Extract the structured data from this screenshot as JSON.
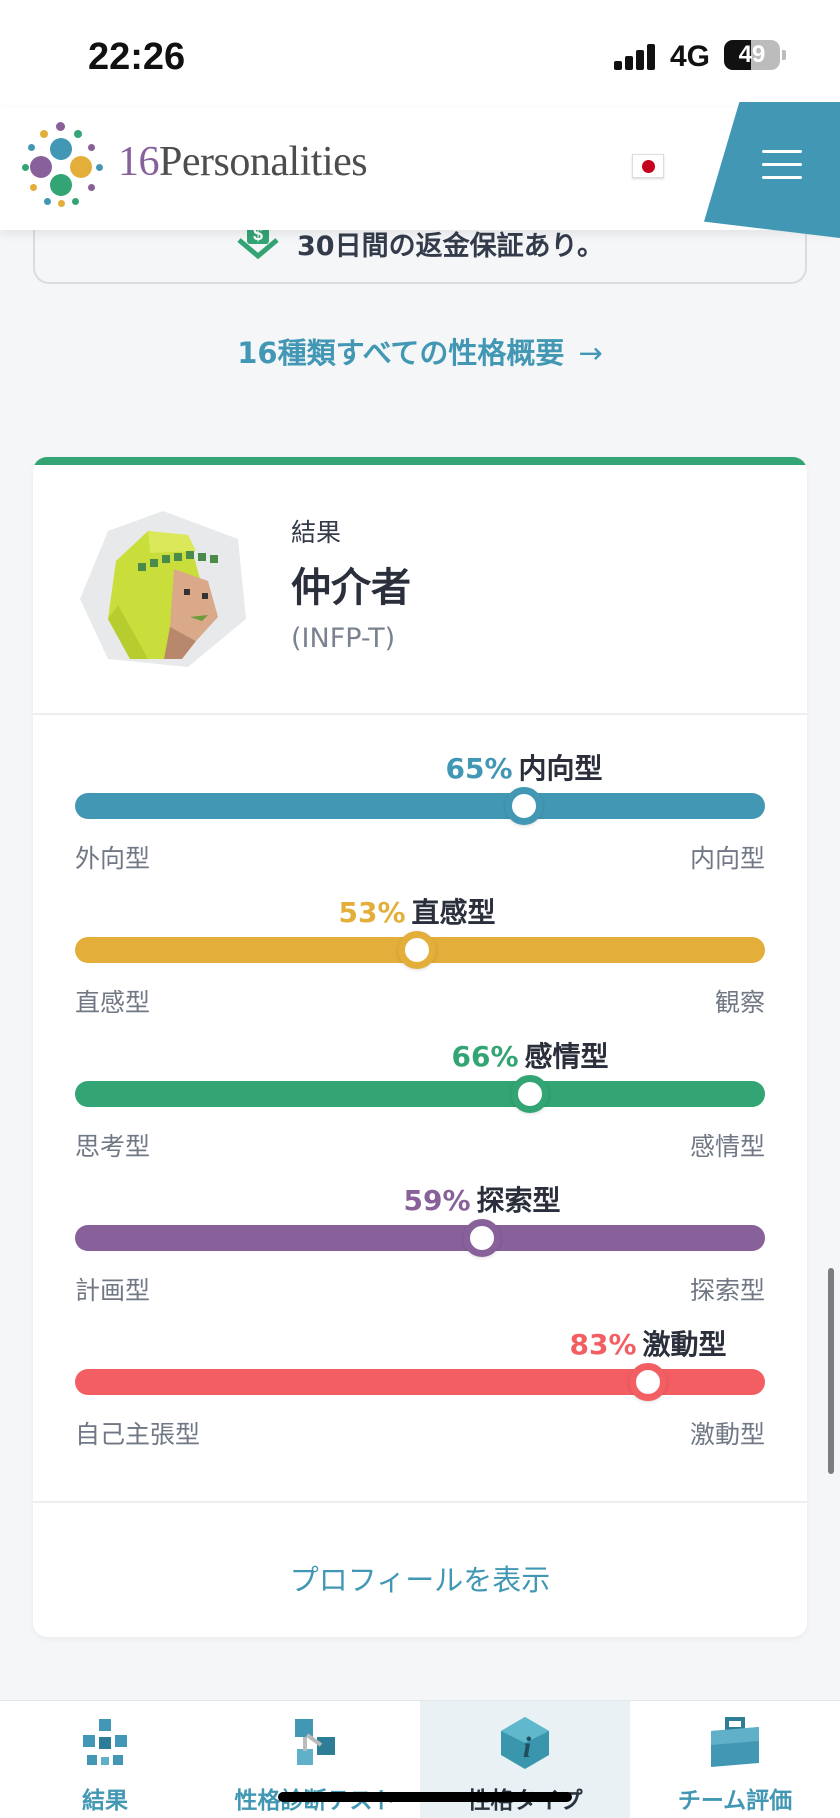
{
  "status_bar": {
    "time": "22:26",
    "network": "4G",
    "battery": "49"
  },
  "header": {
    "logo_number": "16",
    "logo_word": "Personalities",
    "language_flag": "japan-flag",
    "menu_icon": "hamburger-icon"
  },
  "guarantee": {
    "text": "30日間の返金保証あり。",
    "icon": "money-back-icon"
  },
  "overview_link": {
    "label": "16種類すべての性格概要",
    "arrow": "→"
  },
  "result": {
    "label": "結果",
    "name": "仲介者",
    "code": "(INFP-T)",
    "avatar_icon": "mediator-avatar-icon"
  },
  "traits": [
    {
      "percent": "65%",
      "value": 0.65,
      "name": "内向型",
      "left": "外向型",
      "right": "内向型",
      "color": "#4298b4"
    },
    {
      "percent": "53%",
      "value": 0.495,
      "name": "直感型",
      "left": "直感型",
      "right": "観察",
      "color": "#e4ae3a"
    },
    {
      "percent": "66%",
      "value": 0.66,
      "name": "感情型",
      "left": "思考型",
      "right": "感情型",
      "color": "#33a474"
    },
    {
      "percent": "59%",
      "value": 0.59,
      "name": "探索型",
      "left": "計画型",
      "right": "探索型",
      "color": "#88619a"
    },
    {
      "percent": "83%",
      "value": 0.83,
      "name": "激動型",
      "left": "自己主張型",
      "right": "激動型",
      "color": "#f25e62"
    }
  ],
  "profile_link": "プロフィールを表示",
  "bottom_nav": [
    {
      "label": "結果",
      "icon": "molecule-icon",
      "active": false
    },
    {
      "label": "性格診断テスト",
      "icon": "test-cubes-icon",
      "active": false
    },
    {
      "label": "性格タイプ",
      "icon": "info-icon",
      "active": true
    },
    {
      "label": "チーム評価",
      "icon": "briefcase-icon",
      "active": false
    }
  ]
}
